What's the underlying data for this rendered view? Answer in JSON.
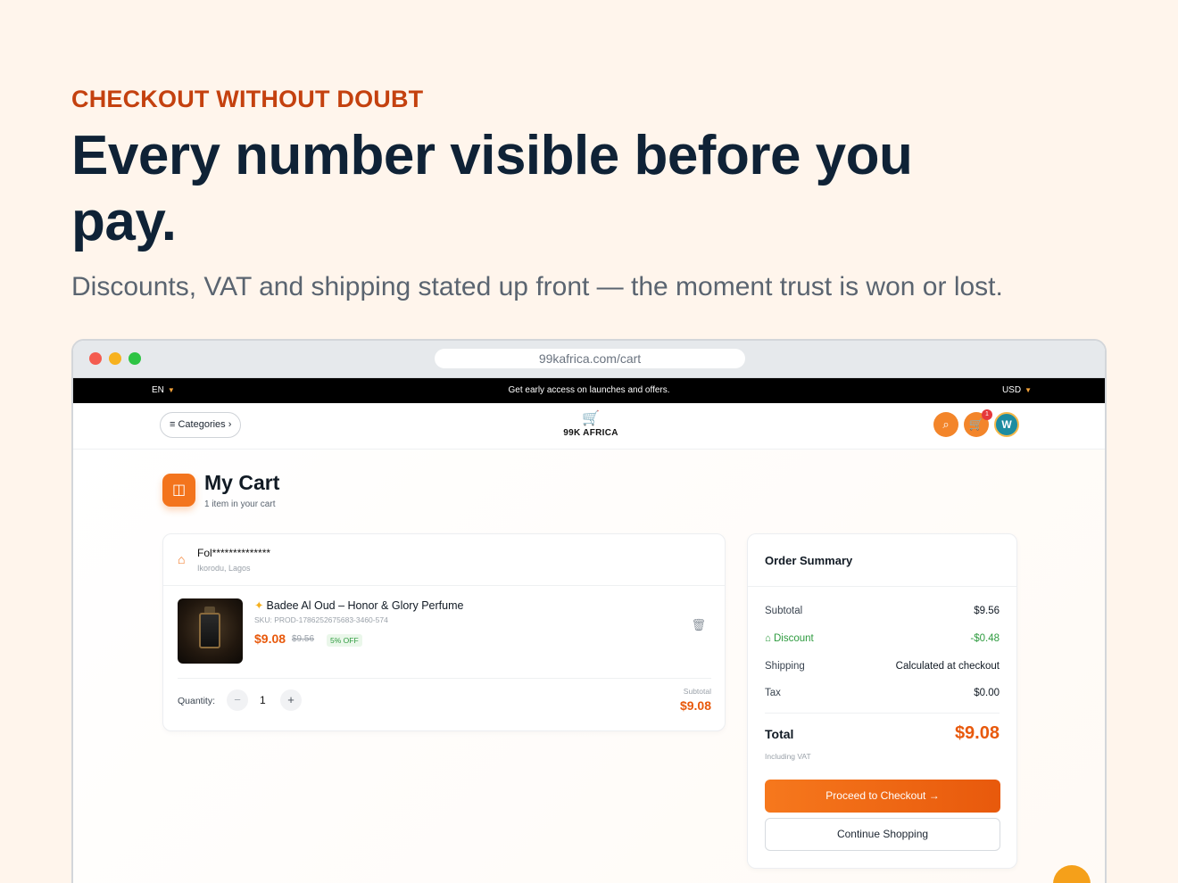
{
  "hero": {
    "eyebrow": "CHECKOUT WITHOUT DOUBT",
    "headline": "Every number visible before you pay.",
    "subhead": "Discounts, VAT and shipping stated up front — the moment trust is won or lost."
  },
  "browser": {
    "url": "99kafrica.com/cart"
  },
  "topbar": {
    "language": "EN",
    "promo": "Get early access on launches and offers.",
    "currency": "USD"
  },
  "nav": {
    "categories_label": "≡ Categories",
    "brand": "99K AFRICA",
    "cart_badge": "1",
    "avatar_initial": "W"
  },
  "cart": {
    "title": "My Cart",
    "item_count": "1 item in your cart",
    "seller": {
      "name": "Fol**************",
      "location": "Ikorodu, Lagos"
    },
    "items": [
      {
        "name": "Badee Al Oud – Honor & Glory Perfume",
        "sku": "SKU: PROD-1786252675683-3460-574",
        "price": "$9.08",
        "old_price": "$9.56",
        "discount_tag": "5% OFF",
        "quantity_label": "Quantity:",
        "quantity": "1",
        "subtotal_label": "Subtotal",
        "subtotal": "$9.08"
      }
    ]
  },
  "summary": {
    "title": "Order Summary",
    "rows": [
      {
        "label": "Subtotal",
        "value": "$9.56"
      },
      {
        "label": "Discount",
        "value": "-$0.48"
      },
      {
        "label": "Shipping",
        "value": "Calculated at checkout"
      },
      {
        "label": "Tax",
        "value": "$0.00"
      }
    ],
    "total_label": "Total",
    "total_value": "$9.08",
    "vat_note": "Including VAT",
    "checkout_label": "Proceed to Checkout →",
    "continue_label": "Continue Shopping"
  },
  "colors": {
    "accent": "#e8590c",
    "eyebrow": "#c4410f",
    "background": "#fff5ec",
    "success": "#2e9b3f"
  }
}
